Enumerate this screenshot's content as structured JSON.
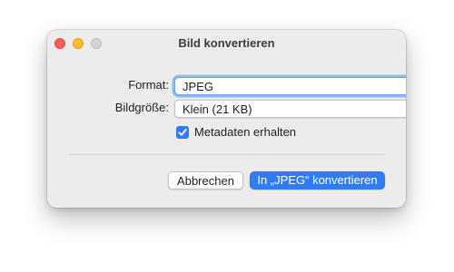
{
  "window": {
    "title": "Bild konvertieren"
  },
  "format": {
    "label": "Format:",
    "value": "JPEG"
  },
  "image_size": {
    "label": "Bildgröße:",
    "value": "Klein (21 KB)"
  },
  "metadata": {
    "label": "Metadaten erhalten",
    "checked": true
  },
  "buttons": {
    "cancel": "Abbrechen",
    "convert": "In „JPEG“ konvertieren"
  },
  "colors": {
    "accent": "#2f7cf6",
    "close": "#fe5f57",
    "minimize": "#febc2e",
    "zoom_inactive": "#d4d4d4",
    "dialog_background": "#ececec"
  },
  "icons": {
    "popup_indicator": "chevron-up-down-icon",
    "checkbox": "checkmark-icon"
  }
}
